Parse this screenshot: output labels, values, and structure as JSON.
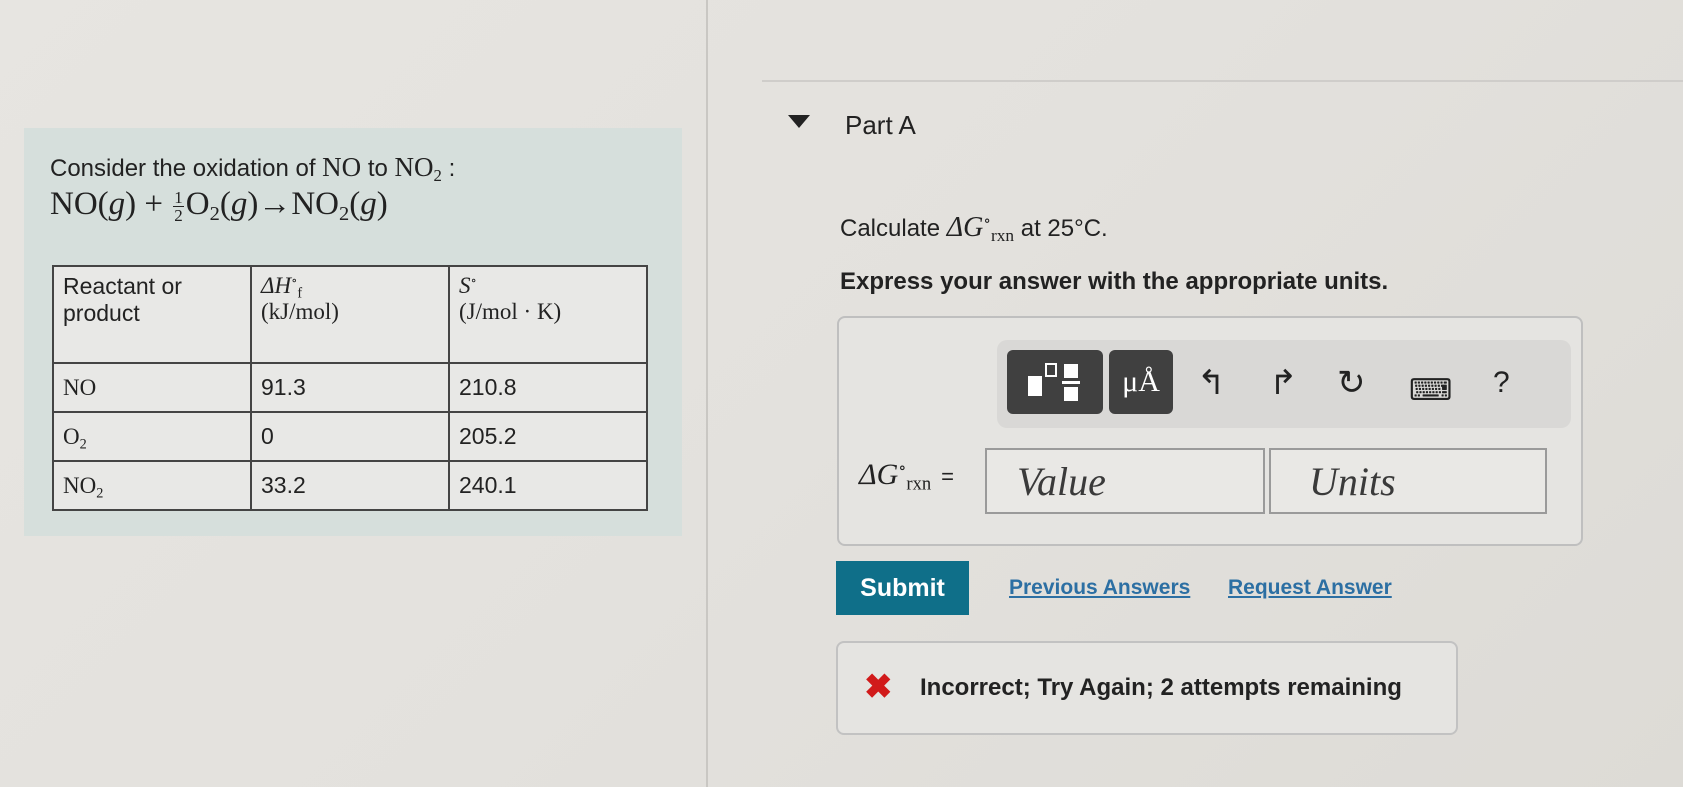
{
  "problem": {
    "intro_prefix": "Consider the oxidation of ",
    "intro_reactant": "NO",
    "intro_mid": " to ",
    "intro_product": "NO",
    "intro_product_sub": "2",
    "intro_suffix": " :",
    "equation": {
      "reactant1": "NO(",
      "state_g": "g",
      "close": ")",
      "plus": " + ",
      "frac_num": "1",
      "frac_den": "2",
      "o": "O",
      "sub2": "2",
      "arrow": "→",
      "product": "NO"
    }
  },
  "table": {
    "header_col1": "Reactant or product",
    "header_col2_sym": "ΔH",
    "header_col2_sup": "∘",
    "header_col2_sub": "f",
    "header_col2_unit": "(kJ/mol)",
    "header_col3_sym": "S",
    "header_col3_sup": "∘",
    "header_col3_unit": "(J/mol · K)",
    "rows": [
      {
        "name": "NO",
        "sub": "",
        "dh": "91.3",
        "s": "210.8"
      },
      {
        "name": "O",
        "sub": "2",
        "dh": "0",
        "s": "205.2"
      },
      {
        "name": "NO",
        "sub": "2",
        "dh": "33.2",
        "s": "240.1"
      }
    ]
  },
  "part": {
    "title": "Part A",
    "question_prefix": "Calculate ",
    "question_sym": "ΔG",
    "question_sup": "∘",
    "question_sub": "rxn",
    "question_suffix": " at 25°C.",
    "instruction": "Express your answer with the appropriate units."
  },
  "toolbar": {
    "units_label": "μÅ",
    "undo_glyph": "↰",
    "redo_glyph": "↱",
    "reset_glyph": "↻",
    "keyboard_glyph": "⌨",
    "help_glyph": "?"
  },
  "answer": {
    "label_sym": "ΔG",
    "label_sup": "∘",
    "label_sub": "rxn",
    "label_eq": "=",
    "value_placeholder": "Value",
    "units_placeholder": "Units"
  },
  "actions": {
    "submit": "Submit",
    "previous_answers": "Previous Answers",
    "request_answer": "Request Answer"
  },
  "feedback": {
    "icon": "✖",
    "text": "Incorrect; Try Again; 2 attempts remaining",
    "icon_color": "#d11a1a"
  },
  "colors": {
    "submit_bg": "#0f6f89",
    "link": "#2c6fa3",
    "panel_bg": "#d6dfdc"
  }
}
